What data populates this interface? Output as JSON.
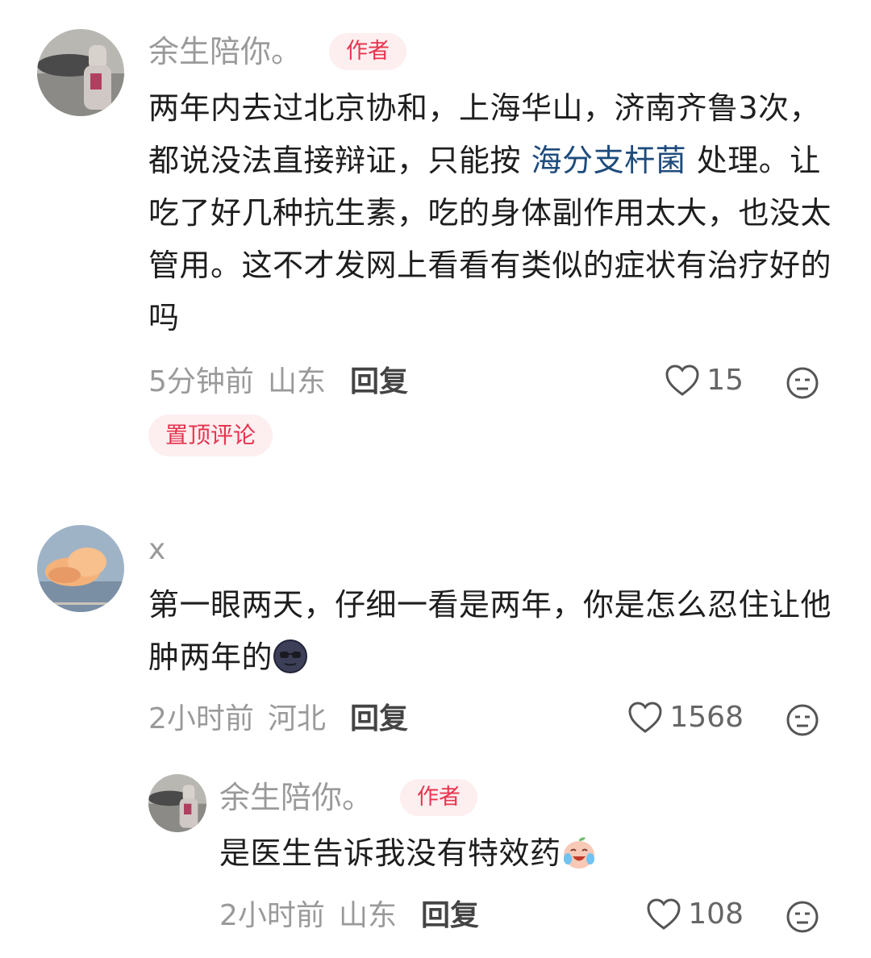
{
  "comments": [
    {
      "author": "余生陪你。",
      "badge": "作者",
      "text_parts": [
        "两年内去过北京协和，上海华山，济南齐鲁3次，都说没法直接辩证，只能按 ",
        "海分支杆菌",
        " 处理。让吃了好几种抗生素，吃的身体副作用太大，也没太管用。这不才发网上看看有类似的症状有治疗好的吗"
      ],
      "link_text": "海分支杆菌",
      "time": "5分钟前",
      "location": "山东",
      "reply_label": "回复",
      "likes": "15",
      "pinned_label": "置顶评论"
    },
    {
      "author": "x",
      "text": "第一眼两天，仔细一看是两年，你是怎么忍住让他肿两年的",
      "emoji": "sunglasses-moon-emoji",
      "time": "2小时前",
      "location": "河北",
      "reply_label": "回复",
      "likes": "1568"
    },
    {
      "author": "余生陪你。",
      "badge": "作者",
      "text": "是医生告诉我没有特效药",
      "emoji": "crying-laughing-emoji",
      "time": "2小时前",
      "location": "山东",
      "reply_label": "回复",
      "likes": "108"
    }
  ],
  "colors": {
    "accent": "#e8344e",
    "tag_bg": "#fdeef0",
    "link": "#1e4b7c",
    "meta": "#9a9a9a"
  }
}
